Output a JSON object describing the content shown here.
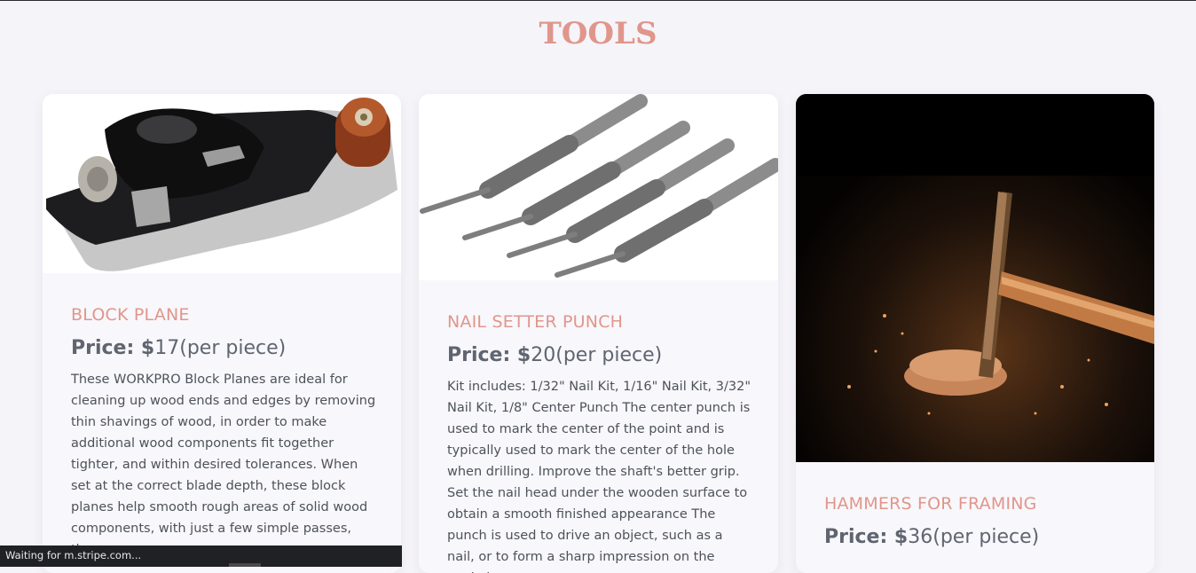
{
  "page": {
    "title": "TOOLS"
  },
  "products": [
    {
      "name": "BLOCK PLANE",
      "price_label": "Price: $",
      "price_value": "17(per piece)",
      "description": "These WORKPRO Block Planes are ideal for cleaning up wood ends and edges by removing thin shavings of wood, in order to make additional wood components fit together tighter, and within desired tolerances. When set at the correct blade depth, these block planes help smooth rough areas of solid wood components, with just a few simple passes, they"
    },
    {
      "name": "NAIL SETTER PUNCH",
      "price_label": "Price: $",
      "price_value": "20(per piece)",
      "description": "Kit includes: 1/32\" Nail Kit, 1/16\" Nail Kit, 3/32\" Nail Kit, 1/8\" Center Punch The center punch is used to mark the center of the point and is typically used to mark the center of the hole when drilling. Improve the shaft's better grip. Set the nail head under the wooden surface to obtain a smooth finished appearance The punch is used to drive an object, such as a nail, or to form a sharp impression on the workpiece."
    },
    {
      "name": "HAMMERS FOR FRAMING",
      "price_label": "Price: $",
      "price_value": "36(per piece)",
      "description": ""
    }
  ],
  "browser_status": {
    "text": "Waiting for m.stripe.com..."
  },
  "colors": {
    "accent": "#e0968b",
    "background": "#f5f4f9",
    "card": "#f8f7fb",
    "text": "#4d525b"
  }
}
